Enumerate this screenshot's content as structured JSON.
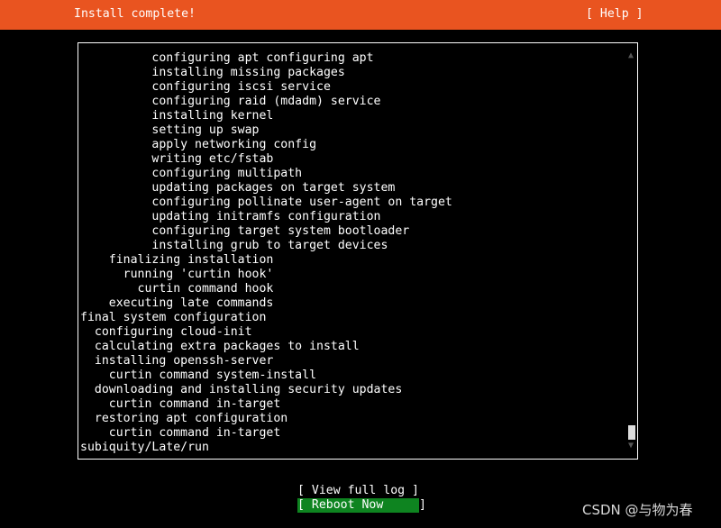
{
  "header": {
    "title": "Install complete!",
    "help_label": "[ Help ]"
  },
  "log": {
    "lines": [
      "          configuring apt configuring apt",
      "          installing missing packages",
      "          configuring iscsi service",
      "          configuring raid (mdadm) service",
      "          installing kernel",
      "          setting up swap",
      "          apply networking config",
      "          writing etc/fstab",
      "          configuring multipath",
      "          updating packages on target system",
      "          configuring pollinate user-agent on target",
      "          updating initramfs configuration",
      "          configuring target system bootloader",
      "          installing grub to target devices",
      "    finalizing installation",
      "      running 'curtin hook'",
      "        curtin command hook",
      "    executing late commands",
      "final system configuration",
      "  configuring cloud-init",
      "  calculating extra packages to install",
      "  installing openssh-server",
      "    curtin command system-install",
      "  downloading and installing security updates",
      "    curtin command in-target",
      "  restoring apt configuration",
      "    curtin command in-target",
      "subiquity/Late/run"
    ],
    "scroll_up_icon": "▲",
    "scroll_down_icon": "▼"
  },
  "buttons": {
    "view_full_log": "[ View full log ]",
    "reboot_now": "[ Reboot Now     ]"
  },
  "watermark": "CSDN @与物为春",
  "colors": {
    "header_bg": "#e95420",
    "selected_button_bg": "#0e8420",
    "background": "#000000",
    "text": "#ffffff"
  }
}
